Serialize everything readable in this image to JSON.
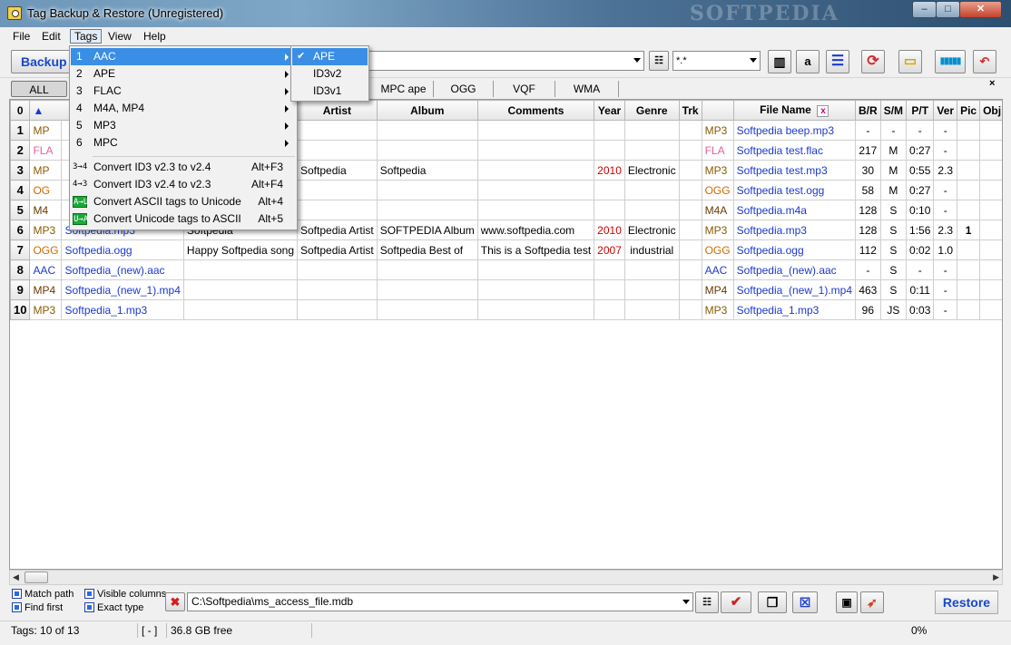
{
  "window": {
    "title": "Tag Backup & Restore (Unregistered)",
    "watermark": "SOFTPEDIA",
    "controls": {
      "minimize": "‒",
      "maximize": "□",
      "close": "✕"
    }
  },
  "menubar": [
    "File",
    "Edit",
    "Tags",
    "View",
    "Help"
  ],
  "toolbar": {
    "backup_label": "Backup",
    "mask_value": "*.*",
    "a_label": "a"
  },
  "tabs": [
    "ALL",
    "MPC ape",
    "OGG",
    "VQF",
    "WMA"
  ],
  "grid": {
    "headers": {
      "num": "0",
      "artist": "Artist",
      "album": "Album",
      "comments": "Comments",
      "year": "Year",
      "genre": "Genre",
      "trk": "Trk",
      "filename": "File Name",
      "close_x": "x",
      "br": "B/R",
      "sm": "S/M",
      "pt": "P/T",
      "ver": "Ver",
      "pic": "Pic",
      "obj": "Obj"
    },
    "rows": [
      {
        "n": "1",
        "lt": "MP",
        "lf": "",
        "title": "",
        "artist": "",
        "album": "",
        "comments": "",
        "year": "",
        "genre": "",
        "trk": "",
        "ft": "MP3",
        "file": "Softpedia beep.mp3",
        "br": "-",
        "sm": "-",
        "pt": "-",
        "ver": "-",
        "pic": ""
      },
      {
        "n": "2",
        "lt": "FLA",
        "lf": "",
        "title": "",
        "artist": "",
        "album": "",
        "comments": "",
        "year": "",
        "genre": "",
        "trk": "",
        "ft": "FLA",
        "file": "Softpedia test.flac",
        "br": "217",
        "sm": "M",
        "pt": "0:27",
        "ver": "-",
        "pic": ""
      },
      {
        "n": "3",
        "lt": "MP",
        "lf": "",
        "title": "",
        "artist": "Softpedia",
        "album": "Softpedia",
        "comments": "",
        "year": "2010",
        "genre": "Electronic",
        "trk": "",
        "ft": "MP3",
        "file": "Softpedia test.mp3",
        "br": "30",
        "sm": "M",
        "pt": "0:55",
        "ver": "2.3",
        "pic": ""
      },
      {
        "n": "4",
        "lt": "OG",
        "lf": "",
        "title": "",
        "artist": "",
        "album": "",
        "comments": "",
        "year": "",
        "genre": "",
        "trk": "",
        "ft": "OGG",
        "file": "Softpedia test.ogg",
        "br": "58",
        "sm": "M",
        "pt": "0:27",
        "ver": "-",
        "pic": ""
      },
      {
        "n": "5",
        "lt": "M4",
        "lf": "",
        "title": "",
        "artist": "",
        "album": "",
        "comments": "",
        "year": "",
        "genre": "",
        "trk": "",
        "ft": "M4A",
        "file": "Softpedia.m4a",
        "br": "128",
        "sm": "S",
        "pt": "0:10",
        "ver": "-",
        "pic": ""
      },
      {
        "n": "6",
        "lt": "MP3",
        "lf": "Softpedia.mp3",
        "title": "Softpedia",
        "artist": "Softpedia Artist",
        "album": "SOFTPEDIA Album",
        "comments": "www.softpedia.com",
        "year": "2010",
        "genre": "Electronic",
        "trk": "",
        "ft": "MP3",
        "file": "Softpedia.mp3",
        "br": "128",
        "sm": "S",
        "pt": "1:56",
        "ver": "2.3",
        "pic": "1"
      },
      {
        "n": "7",
        "lt": "OGG",
        "lf": "Softpedia.ogg",
        "title": "Happy Softpedia song",
        "artist": "Softpedia Artist",
        "album": "Softpedia Best of",
        "comments": "This is a Softpedia test",
        "year": "2007",
        "genre": "industrial",
        "trk": "",
        "ft": "OGG",
        "file": "Softpedia.ogg",
        "br": "112",
        "sm": "S",
        "pt": "0:02",
        "ver": "1.0",
        "pic": ""
      },
      {
        "n": "8",
        "lt": "AAC",
        "lf": "Softpedia_(new).aac",
        "title": "",
        "artist": "",
        "album": "",
        "comments": "",
        "year": "",
        "genre": "",
        "trk": "",
        "ft": "AAC",
        "file": "Softpedia_(new).aac",
        "br": "-",
        "sm": "S",
        "pt": "-",
        "ver": "-",
        "pic": ""
      },
      {
        "n": "9",
        "lt": "MP4",
        "lf": "Softpedia_(new_1).mp4",
        "title": "",
        "artist": "",
        "album": "",
        "comments": "",
        "year": "",
        "genre": "",
        "trk": "",
        "ft": "MP4",
        "file": "Softpedia_(new_1).mp4",
        "br": "463",
        "sm": "S",
        "pt": "0:11",
        "ver": "-",
        "pic": ""
      },
      {
        "n": "10",
        "lt": "MP3",
        "lf": "Softpedia_1.mp3",
        "title": "",
        "artist": "",
        "album": "",
        "comments": "",
        "year": "",
        "genre": "",
        "trk": "",
        "ft": "MP3",
        "file": "Softpedia_1.mp3",
        "br": "96",
        "sm": "JS",
        "pt": "0:03",
        "ver": "-",
        "pic": ""
      }
    ]
  },
  "tags_menu": {
    "items": [
      {
        "num": "1",
        "label": "AAC",
        "submenu": true,
        "highlighted": true
      },
      {
        "num": "2",
        "label": "APE",
        "submenu": true
      },
      {
        "num": "3",
        "label": "FLAC",
        "submenu": true
      },
      {
        "num": "4",
        "label": "M4A, MP4",
        "submenu": true
      },
      {
        "num": "5",
        "label": "MP3",
        "submenu": true
      },
      {
        "num": "6",
        "label": "MPC",
        "submenu": true
      }
    ],
    "commands": [
      {
        "icon": "3→4",
        "label": "Convert  ID3 v2.3 to v2.4",
        "shortcut": "Alt+F3"
      },
      {
        "icon": "4→3",
        "label": "Convert  ID3 v2.4 to v2.3",
        "shortcut": "Alt+F4"
      },
      {
        "icon": "A→U",
        "label": "Convert  ASCII tags to Unicode",
        "shortcut": "Alt+4"
      },
      {
        "icon": "U→A",
        "label": "Convert  Unicode tags to ASCII",
        "shortcut": "Alt+5"
      }
    ]
  },
  "aac_submenu": [
    {
      "label": "APE",
      "checked": true
    },
    {
      "label": "ID3v2",
      "checked": false
    },
    {
      "label": "ID3v1",
      "checked": false
    }
  ],
  "bottom": {
    "match_path": "Match path",
    "find_first": "Find first",
    "visible_columns": "Visible columns",
    "exact_type": "Exact type",
    "db_path": "C:\\Softpedia\\ms_access_file.mdb",
    "restore_label": "Restore"
  },
  "status": {
    "tags": "Tags: 10 of 13",
    "mode": "[ - ]",
    "free": "36.8 GB free",
    "progress": "0%"
  },
  "colors": {
    "accent_blue": "#1a48c8",
    "menu_highlight": "#3b8ee6",
    "year_red": "#d00000"
  }
}
